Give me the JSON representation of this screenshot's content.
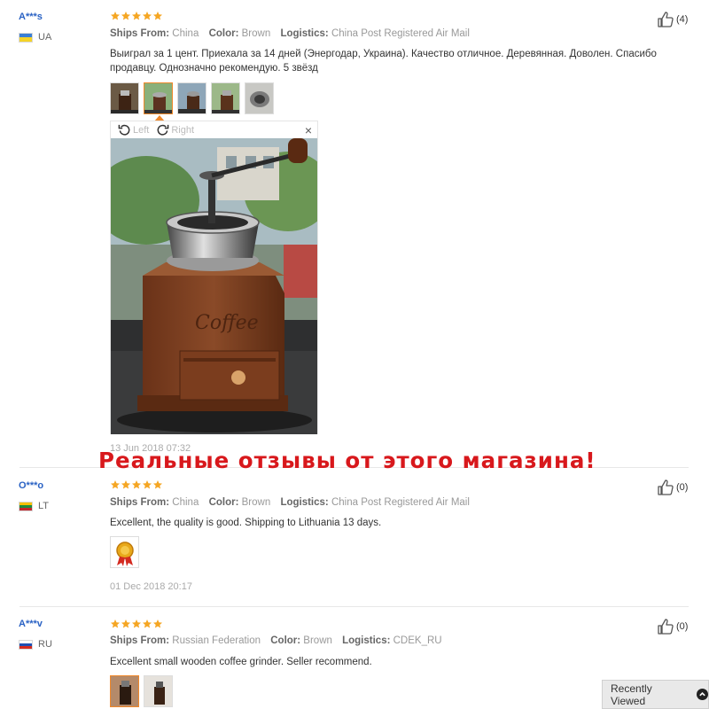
{
  "labels": {
    "ships_from": "Ships From:",
    "color": "Color:",
    "logistics": "Logistics:"
  },
  "viewer": {
    "left_label": "Left",
    "right_label": "Right",
    "close_label": "×",
    "photo_label": "Coffee"
  },
  "reviews": [
    {
      "user": "A***s",
      "country": "UA",
      "flag_colors": [
        "#3a7fd5",
        "#f5d327"
      ],
      "rating": 5,
      "ships_from": "China",
      "color": "Brown",
      "logistics": "China Post Registered Air Mail",
      "text": "Выиграл за 1 цент. Приехала за 14 дней (Энергодар, Украина). Качество отличное. Деревянная. Доволен. Спасибо продавцу. Однозначно рекомендую. 5 звёзд",
      "photos": 5,
      "active_photo": 2,
      "date": "13 Jun 2018 07:32",
      "likes": "(4)"
    },
    {
      "user": "O***o",
      "country": "LT",
      "flag_colors": [
        "#f5c000",
        "#1e8a3e",
        "#c1272d"
      ],
      "rating": 5,
      "ships_from": "China",
      "color": "Brown",
      "logistics": "China Post Registered Air Mail",
      "text": "Excellent, the quality is good. Shipping to Lithuania 13 days.",
      "photos": 1,
      "date": "01 Dec 2018 20:17",
      "likes": "(0)"
    },
    {
      "user": "A***v",
      "country": "RU",
      "flag_colors": [
        "#ffffff",
        "#1d4fb3",
        "#d52b1e"
      ],
      "rating": 5,
      "ships_from": "Russian Federation",
      "color": "Brown",
      "logistics": "CDEK_RU",
      "text": "Excellent small wooden coffee grinder. Seller recommend.",
      "photos": 2,
      "likes": "(0)"
    }
  ],
  "banner_text": "Реальные отзывы от этого магазина!",
  "recently_viewed": "Recently Viewed",
  "colors": {
    "star": "#f5a623",
    "username": "#2a62c4",
    "banner": "#d8181c",
    "active_thumb": "#f0882a"
  }
}
